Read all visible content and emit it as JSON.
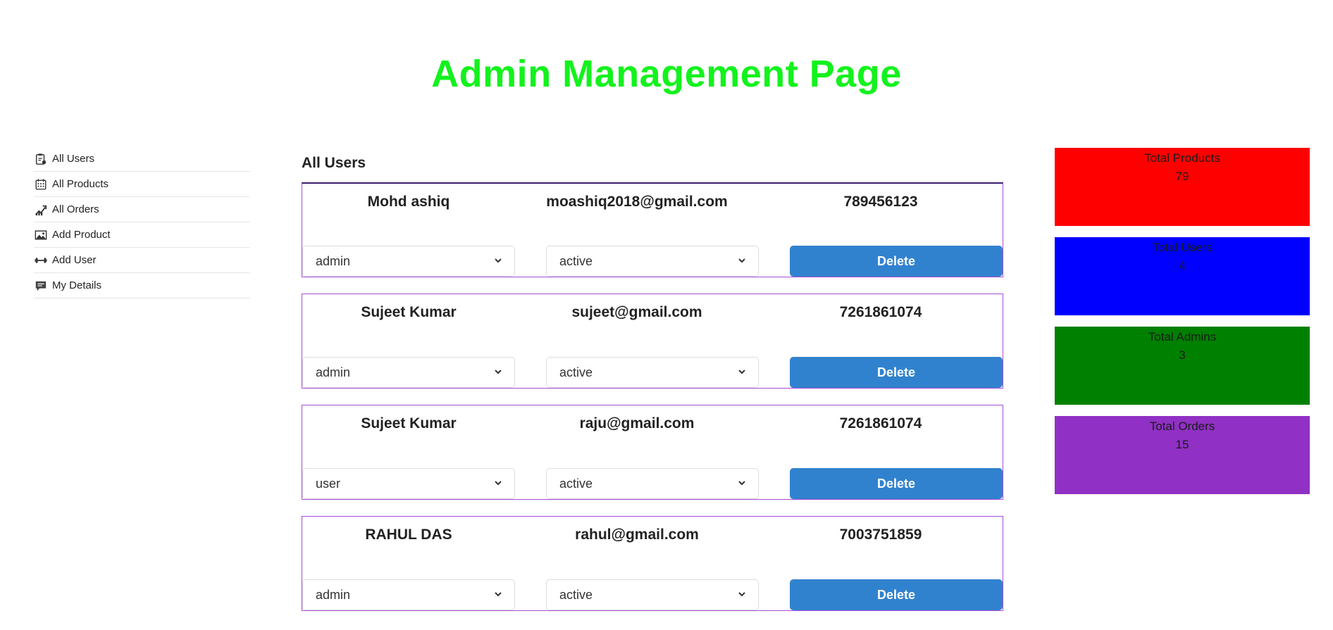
{
  "page_title": "Admin Management Page",
  "colors": {
    "title": "#13f21d",
    "delete_button": "#3182ce",
    "card_border": "#a64dd6",
    "stat_products": "#ff0000",
    "stat_users": "#0000ff",
    "stat_admins": "#008000",
    "stat_orders": "#9030c4"
  },
  "sidebar": {
    "items": [
      {
        "label": "All Users",
        "icon": "clipboard-icon"
      },
      {
        "label": "All Products",
        "icon": "calendar-grid-icon"
      },
      {
        "label": "All Orders",
        "icon": "trending-chart-icon"
      },
      {
        "label": "Add Product",
        "icon": "image-icon"
      },
      {
        "label": "Add User",
        "icon": "dumbbell-icon"
      },
      {
        "label": "My Details",
        "icon": "comment-icon"
      }
    ]
  },
  "main": {
    "section_title": "All Users",
    "users": [
      {
        "name": "Mohd ashiq",
        "email": "moashiq2018@gmail.com",
        "phone": "789456123",
        "role": "admin",
        "status": "active",
        "delete_label": "Delete"
      },
      {
        "name": "Sujeet Kumar",
        "email": "sujeet@gmail.com",
        "phone": "7261861074",
        "role": "admin",
        "status": "active",
        "delete_label": "Delete"
      },
      {
        "name": "Sujeet Kumar",
        "email": "raju@gmail.com",
        "phone": "7261861074",
        "role": "user",
        "status": "active",
        "delete_label": "Delete"
      },
      {
        "name": "RAHUL DAS",
        "email": "rahul@gmail.com",
        "phone": "7003751859",
        "role": "admin",
        "status": "active",
        "delete_label": "Delete"
      }
    ]
  },
  "stats": {
    "products": {
      "label": "Total Products",
      "value": "79"
    },
    "users": {
      "label": "Total Users",
      "value": "4"
    },
    "admins": {
      "label": "Total Admins",
      "value": "3"
    },
    "orders": {
      "label": "Total Orders",
      "value": "15"
    }
  }
}
